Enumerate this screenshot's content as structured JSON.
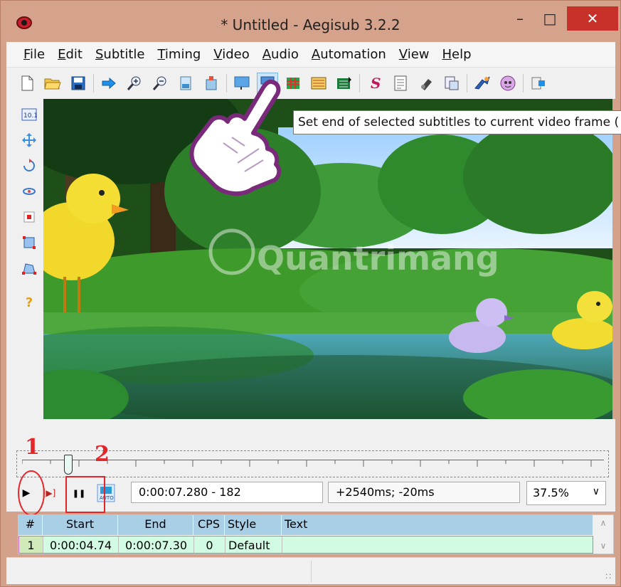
{
  "window": {
    "title": "* Untitled - Aegisub 3.2.2",
    "minimize": "–",
    "maximize": "□",
    "close": "✕"
  },
  "menubar": [
    "File",
    "Edit",
    "Subtitle",
    "Timing",
    "Video",
    "Audio",
    "Automation",
    "View",
    "Help"
  ],
  "toolbar": {
    "icons": [
      "new-file-icon",
      "open-folder-icon",
      "save-icon",
      "jump-to-icon",
      "zoom-in-icon",
      "zoom-out-icon",
      "video-open-icon",
      "video-close-icon",
      "set-start-icon",
      "set-end-icon",
      "shift-times-icon",
      "timing-icon",
      "keyframes-icon",
      "styles-icon",
      "properties-icon",
      "attachments-icon",
      "translation-icon",
      "spell-check-icon",
      "automation-icon",
      "options-icon",
      "exit-icon"
    ],
    "tooltip": "Set end of selected subtitles to current video frame ("
  },
  "lefttools": [
    "standard-tool-icon",
    "drag-tool-icon",
    "rotate-z-icon",
    "rotate-xy-icon",
    "scale-icon",
    "clip-icon",
    "vector-clip-icon",
    "help-icon"
  ],
  "video_controls": {
    "play": "▶",
    "play_line": "[▶]",
    "pause": "❚❚",
    "auto": "AUTO",
    "time": "0:00:07.280 - 182",
    "offset": "+2540ms; -20ms",
    "zoom": "37.5%",
    "zoom_chevron": "∨"
  },
  "annotations": {
    "marker1": "1",
    "marker2": "2"
  },
  "grid": {
    "headers": {
      "num": "#",
      "start": "Start",
      "end": "End",
      "cps": "CPS",
      "style": "Style",
      "text": "Text"
    },
    "rows": [
      {
        "num": "1",
        "start": "0:00:04.74",
        "end": "0:00:07.30",
        "cps": "0",
        "style": "Default",
        "text": ""
      }
    ],
    "scroll_up": "∧",
    "scroll_down": "∨"
  },
  "statusbar": {
    "grip": "∷"
  },
  "watermark": "Quantrimang",
  "colors": {
    "titlebar": "#d5a38b",
    "close": "#c8302a",
    "annotation": "#e3262a",
    "grid_header": "#a9cfe6",
    "grid_row": "#d2fbe3"
  }
}
